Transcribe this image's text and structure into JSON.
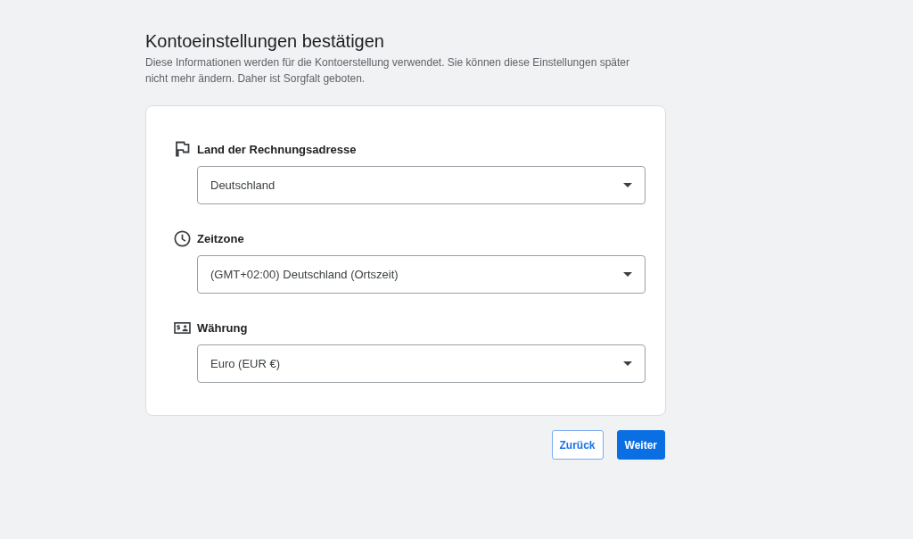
{
  "header": {
    "title": "Kontoeinstellungen bestätigen",
    "description": "Diese Informationen werden für die Kontoerstellung verwendet. Sie können diese Einstellungen später nicht mehr ändern. Daher ist Sorgfalt geboten."
  },
  "fields": [
    {
      "label": "Land der Rechnungsadresse",
      "value": "Deutschland"
    },
    {
      "label": "Zeitzone",
      "value": "(GMT+02:00) Deutschland (Ortszeit)"
    },
    {
      "label": "Währung",
      "value": "Euro (EUR €)"
    }
  ],
  "buttons": [
    {
      "label": "Zurück",
      "kind": "outlined"
    },
    {
      "label": "Weiter",
      "kind": "filled"
    }
  ]
}
